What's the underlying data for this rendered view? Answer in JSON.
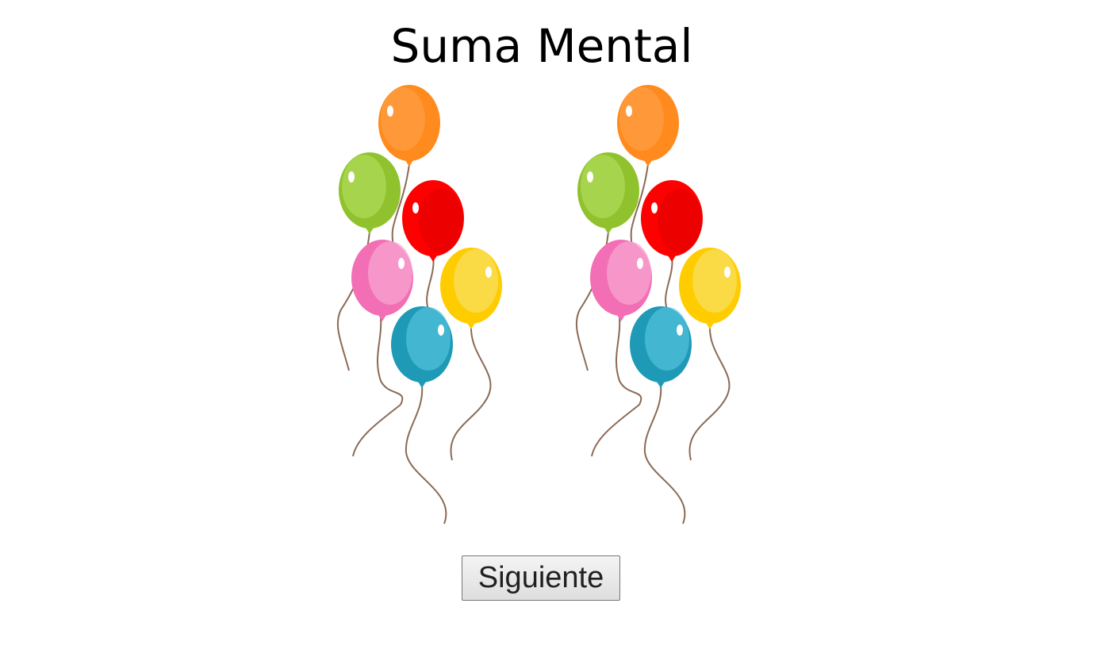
{
  "page": {
    "title": "Suma Mental"
  },
  "balloon_groups": [
    {
      "name": "left-balloon-bunch",
      "count": 6
    },
    {
      "name": "right-balloon-bunch",
      "count": 6
    }
  ],
  "balloon_colors": {
    "orange": "#ff8a1e",
    "green": "#9ccf3a",
    "red": "#ff0000",
    "pink": "#f36fb5",
    "yellow": "#ffd42a",
    "blue": "#34aeca"
  },
  "actions": {
    "next_label": "Siguiente"
  }
}
